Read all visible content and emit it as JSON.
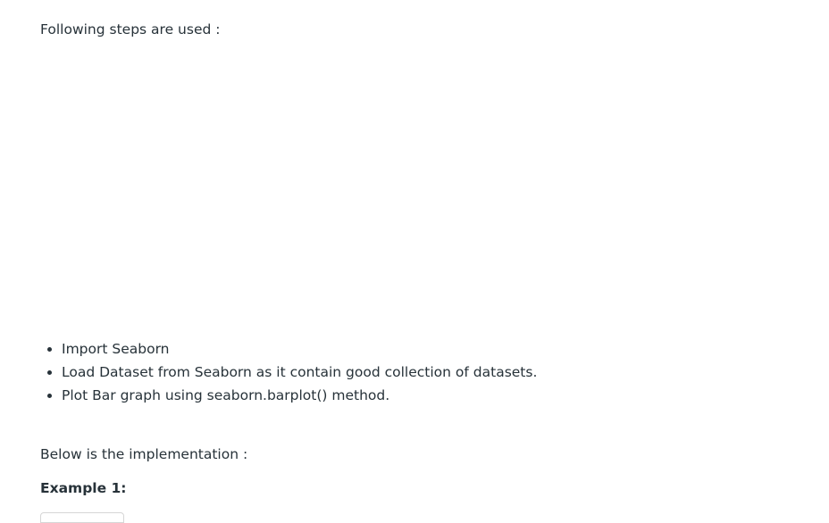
{
  "article": {
    "intro_text": "Following steps are used :",
    "steps": [
      "Import Seaborn",
      "Load Dataset from Seaborn as it contain good collection of datasets.",
      "Plot Bar graph using seaborn.barplot() method."
    ],
    "below_text": "Below is the implementation :",
    "example_heading": "Example 1:"
  },
  "colors": {
    "text": "#273239",
    "background": "#ffffff"
  }
}
